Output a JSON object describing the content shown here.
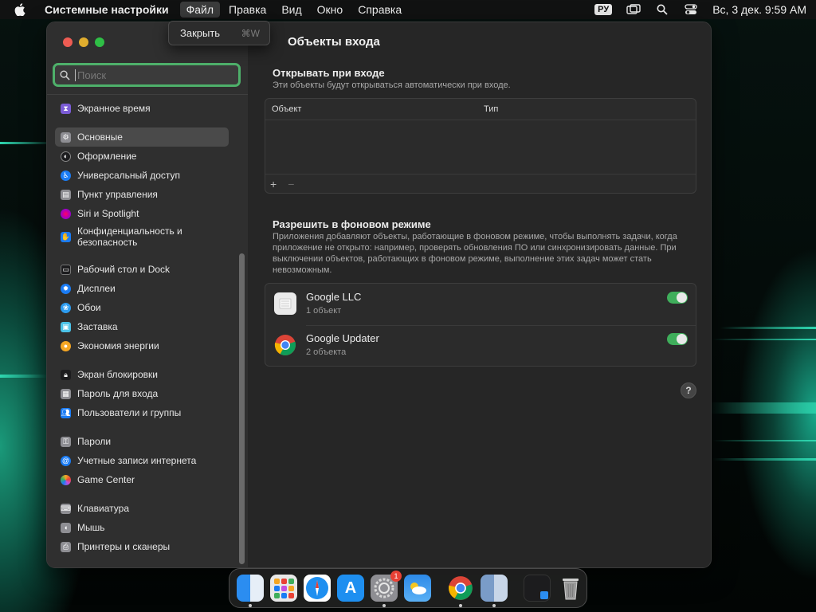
{
  "menubar": {
    "app_name": "Системные настройки",
    "menus": [
      "Файл",
      "Правка",
      "Вид",
      "Окно",
      "Справка"
    ],
    "input_language": "РУ",
    "clock": "Вс, 3 дек.  9:59 AM"
  },
  "file_menu": {
    "items": [
      {
        "label": "Закрыть",
        "shortcut": "⌘W"
      }
    ]
  },
  "sidebar": {
    "search_placeholder": "Поиск",
    "items": [
      {
        "label": "Экранное время",
        "icon": "hourglass-icon",
        "color": "#7b5cd6"
      },
      {
        "label": "Основные",
        "icon": "gear-icon",
        "color": "#8e8e93",
        "selected": true
      },
      {
        "label": "Оформление",
        "icon": "appearance-icon",
        "color": "#1c1c1e"
      },
      {
        "label": "Универсальный доступ",
        "icon": "accessibility-icon",
        "color": "#1a7cf5"
      },
      {
        "label": "Пункт управления",
        "icon": "control-center-icon",
        "color": "#8e8e93"
      },
      {
        "label": "Siri и Spotlight",
        "icon": "siri-icon",
        "color": "#c34fe0"
      },
      {
        "label": "Конфиденциальность и безопасность",
        "icon": "hand-icon",
        "color": "#1a7cf5"
      },
      {
        "label": "Рабочий стол и Dock",
        "icon": "dock-icon",
        "color": "#1c1c1e"
      },
      {
        "label": "Дисплеи",
        "icon": "display-icon",
        "color": "#1a7cf5"
      },
      {
        "label": "Обои",
        "icon": "wallpaper-icon",
        "color": "#2d9cf0"
      },
      {
        "label": "Заставка",
        "icon": "screensaver-icon",
        "color": "#4cc3e8"
      },
      {
        "label": "Экономия энергии",
        "icon": "energy-icon",
        "color": "#f5a623"
      },
      {
        "label": "Экран блокировки",
        "icon": "lock-screen-icon",
        "color": "#1c1c1e"
      },
      {
        "label": "Пароль для входа",
        "icon": "login-password-icon",
        "color": "#8e8e93"
      },
      {
        "label": "Пользователи и группы",
        "icon": "users-icon",
        "color": "#1a7cf5"
      },
      {
        "label": "Пароли",
        "icon": "key-icon",
        "color": "#8e8e93"
      },
      {
        "label": "Учетные записи интернета",
        "icon": "at-icon",
        "color": "#1a7cf5"
      },
      {
        "label": "Game Center",
        "icon": "game-center-icon",
        "color": "#e8e8e8"
      },
      {
        "label": "Клавиатура",
        "icon": "keyboard-icon",
        "color": "#8e8e93"
      },
      {
        "label": "Мышь",
        "icon": "mouse-icon",
        "color": "#8e8e93"
      },
      {
        "label": "Принтеры и сканеры",
        "icon": "printer-icon",
        "color": "#8e8e93"
      }
    ]
  },
  "main": {
    "title": "Объекты входа",
    "open_at_login": {
      "title": "Открывать при входе",
      "subtitle": "Эти объекты будут открываться автоматически при входе.",
      "columns": [
        "Объект",
        "Тип"
      ],
      "add_label": "+",
      "remove_label": "−"
    },
    "background": {
      "title": "Разрешить в фоновом режиме",
      "description": "Приложения добавляют объекты, работающие в фоновом режиме, чтобы выполнять задачи, когда приложение не открыто: например, проверять обновления ПО или синхронизировать данные. При выключении объектов, работающих в фоновом режиме, выполнение этих задач может стать невозможным.",
      "items": [
        {
          "name": "Google LLC",
          "count": "1 объект",
          "enabled": true,
          "icon": "google-llc-icon"
        },
        {
          "name": "Google Updater",
          "count": "2 объекта",
          "enabled": true,
          "icon": "chrome-icon"
        }
      ]
    },
    "help_label": "?"
  },
  "dock": {
    "apps": [
      {
        "name": "finder-icon",
        "color": "#2b8df0",
        "running": true
      },
      {
        "name": "launchpad-icon",
        "color": "#e8e8e8"
      },
      {
        "name": "safari-icon",
        "color": "#1e8ff0"
      },
      {
        "name": "app-store-icon",
        "color": "#1e8ff0"
      },
      {
        "name": "system-settings-icon",
        "color": "#8e8e93",
        "badge": "1",
        "running": true
      },
      {
        "name": "weather-icon",
        "color": "#2d8ae8"
      },
      {
        "name": "chrome-icon",
        "color": "#ffffff",
        "running": true
      },
      {
        "name": "migration-assistant-icon",
        "color": "#7a9cc8",
        "running": true
      },
      {
        "name": "downloads-folder-icon",
        "color": "#1c1c1e"
      },
      {
        "name": "trash-icon",
        "color": "#9a9a9a"
      }
    ]
  }
}
